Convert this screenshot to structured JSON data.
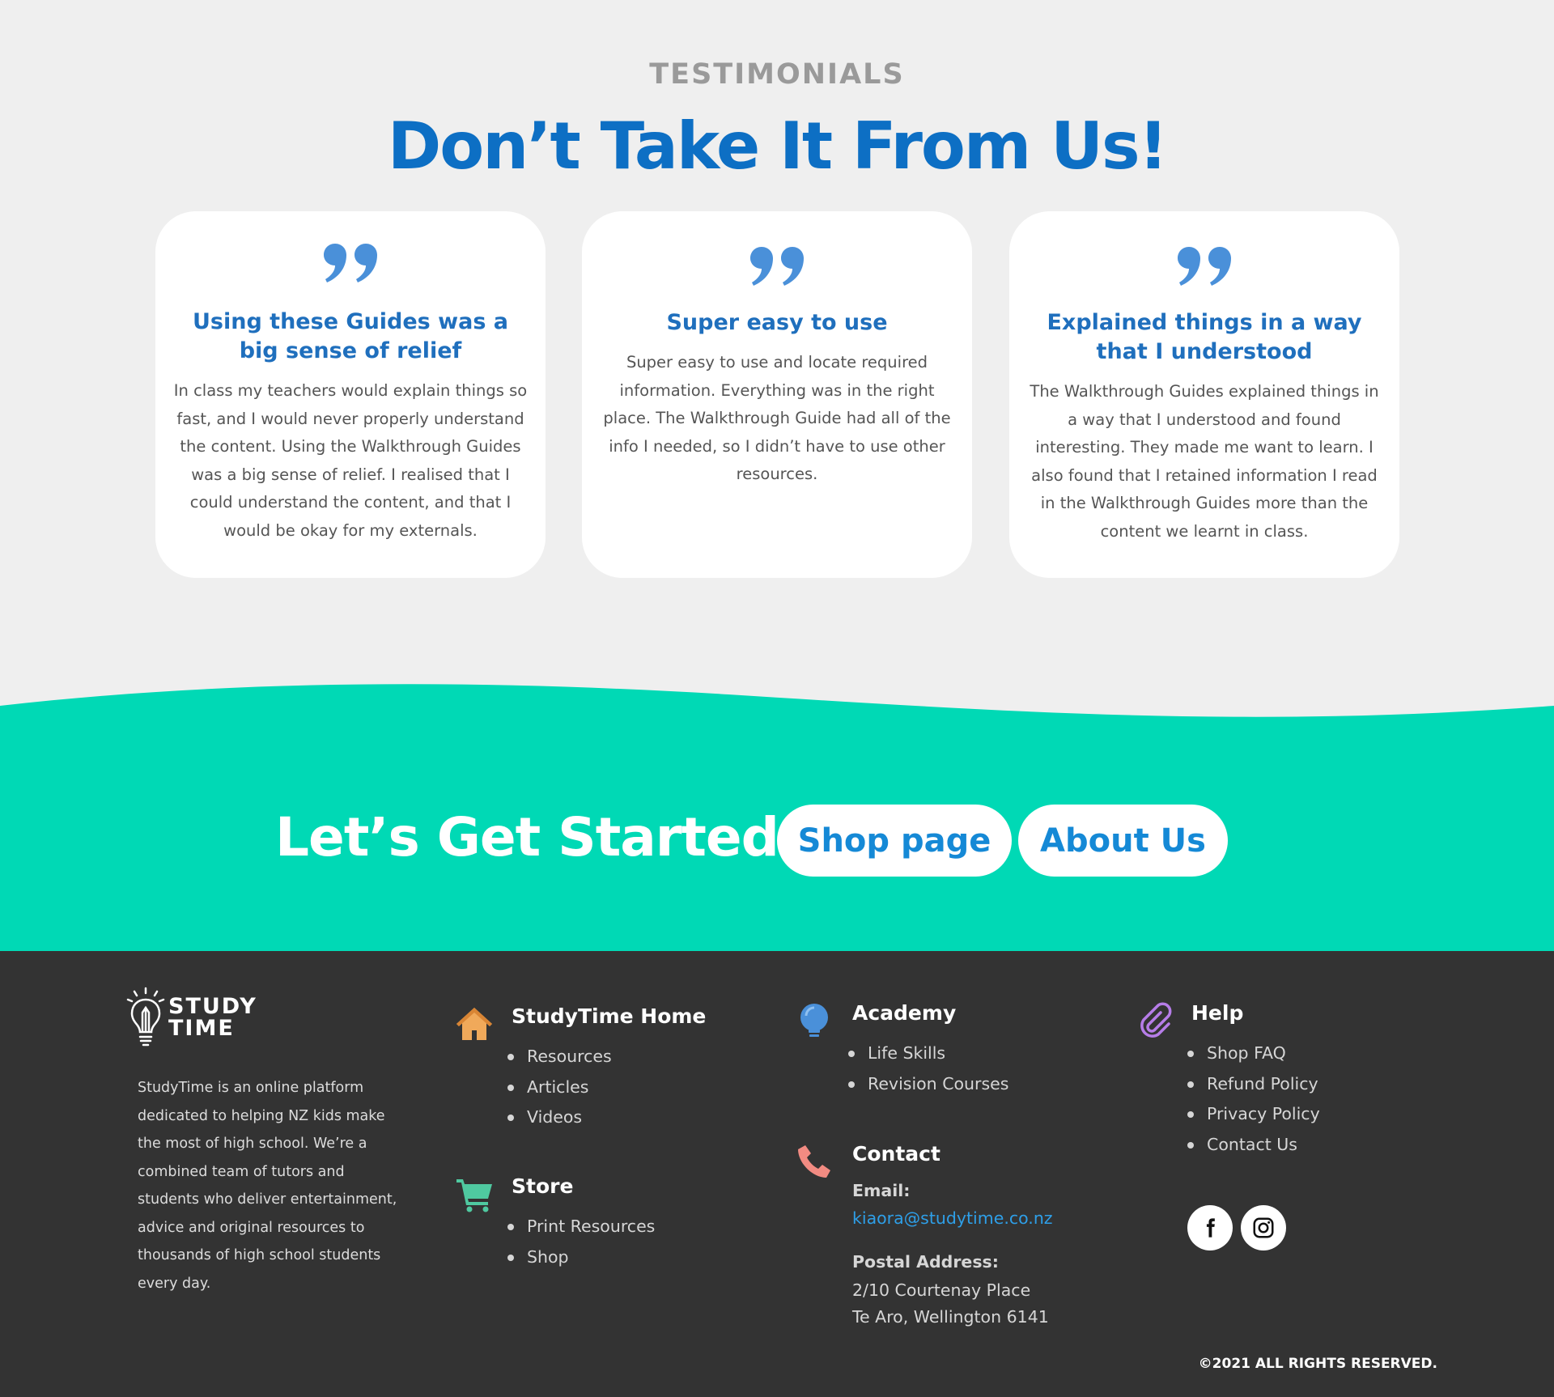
{
  "testimonials": {
    "eyebrow": "TESTIMONIALS",
    "heading": "Don’t Take It From Us!",
    "quote_color": "#4a90d9",
    "cards": [
      {
        "title": "Using these Guides was a big sense of relief",
        "body": "In class my teachers would explain things so fast, and I would never properly understand the content. Using the Walkthrough Guides was a big sense of relief. I realised that I could understand the content, and that I would be okay for my externals."
      },
      {
        "title": "Super easy to use",
        "body": "Super easy to use and locate required information. Everything was in the right place. The Walkthrough Guide had all of the info I needed, so I didn’t have to use other resources."
      },
      {
        "title": "Explained things in a way that I understood",
        "body": "The Walkthrough Guides explained things in a way that I understood and found interesting. They made me want to learn. I also found that I retained information I read in the Walkthrough Guides more than the content we learnt in class."
      }
    ]
  },
  "cta": {
    "title": "Let’s Get Started!",
    "shop_button": "Shop page",
    "about_button": "About Us",
    "background": "#00d9b5"
  },
  "footer": {
    "logo_line1": "STUDY",
    "logo_line2": "TIME",
    "about": "StudyTime is an online platform dedicated to helping NZ kids make the most of high school. We’re a combined team of tutors and students who deliver entertainment, advice and original resources to thousands of high school students every day.",
    "home": {
      "icon": "house-icon",
      "title": "StudyTime Home",
      "links": [
        "Resources",
        "Articles",
        "Videos"
      ]
    },
    "store": {
      "icon": "cart-icon",
      "title": "Store",
      "links": [
        "Print Resources",
        "Shop"
      ]
    },
    "academy": {
      "icon": "lightbulb-icon",
      "title": "Academy",
      "links": [
        "Life Skills",
        "Revision Courses"
      ]
    },
    "contact": {
      "icon": "phone-icon",
      "title": "Contact",
      "email_label": "Email:",
      "email": "kiaora@studytime.co.nz",
      "postal_label": "Postal Address:",
      "address_line1": "2/10 Courtenay Place",
      "address_line2": "Te Aro, Wellington 6141"
    },
    "help": {
      "icon": "paperclip-icon",
      "title": "Help",
      "links": [
        "Shop FAQ",
        "Refund Policy",
        "Privacy Policy",
        "Contact Us"
      ]
    },
    "social": [
      "facebook-icon",
      "instagram-icon"
    ],
    "copyright": "©2021 ALL RIGHTS RESERVED."
  }
}
